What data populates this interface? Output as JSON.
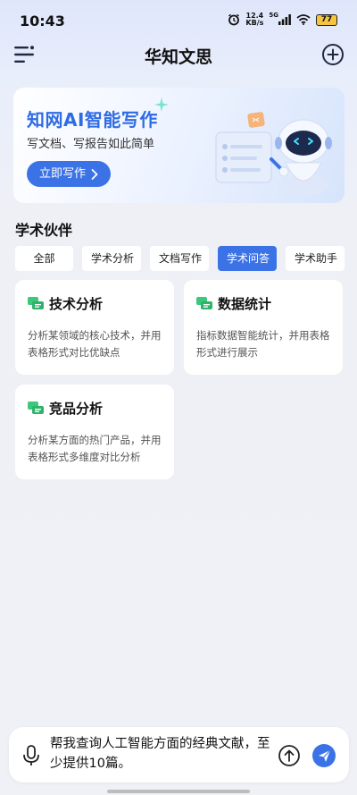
{
  "status": {
    "time": "10:43",
    "net_speed_value": "12.4",
    "net_speed_unit": "KB/s",
    "signal": "5G",
    "battery": "77"
  },
  "header": {
    "title": "华知文思",
    "menu_icon": "menu-icon",
    "add_icon": "plus-circle-icon"
  },
  "banner": {
    "title": "知网AI智能写作",
    "subtitle": "写文档、写报告如此简单",
    "button_label": "立即写作"
  },
  "section": {
    "title": "学术伙伴",
    "tabs": [
      {
        "label": "全部",
        "active": false
      },
      {
        "label": "学术分析",
        "active": false
      },
      {
        "label": "文档写作",
        "active": false
      },
      {
        "label": "学术问答",
        "active": true
      },
      {
        "label": "学术助手",
        "active": false
      }
    ]
  },
  "cards": [
    {
      "title": "技术分析",
      "desc": "分析某领域的核心技术，并用表格形式对比优缺点"
    },
    {
      "title": "数据统计",
      "desc": "指标数据智能统计，并用表格形式进行展示"
    },
    {
      "title": "竞品分析",
      "desc": "分析某方面的热门产品，并用表格形式多维度对比分析"
    }
  ],
  "input": {
    "value": "帮我查询人工智能方面的经典文献，至少提供10篇。"
  },
  "colors": {
    "accent": "#3b73e6",
    "card_icon": "#3cc87a"
  }
}
